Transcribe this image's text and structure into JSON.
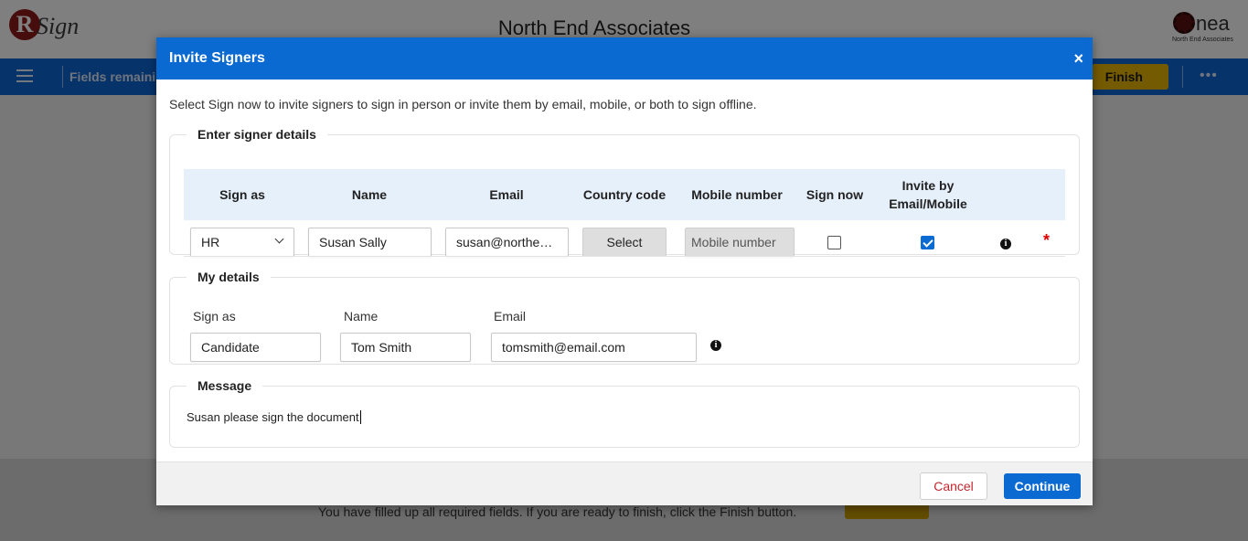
{
  "app": {
    "title": "North End Associates",
    "brand_logo": {
      "letter": "R",
      "text": "Sign"
    },
    "company_logo": {
      "text": "nea",
      "subtitle": "North End Associates"
    },
    "toolbar": {
      "fields_remaining_label": "Fields remainin",
      "finish_label": "Finish",
      "more_label": "•••"
    },
    "footer": {
      "message": "You have filled up all required fields. If you are ready to finish, click the Finish button."
    }
  },
  "modal": {
    "title": "Invite Signers",
    "close_label": "×",
    "intro": "Select Sign now to invite signers to sign in person or invite them by email, mobile, or both to sign offline.",
    "signer_section": {
      "legend": "Enter signer details",
      "columns": {
        "sign_as": "Sign as",
        "name": "Name",
        "email": "Email",
        "country_code": "Country code",
        "mobile_number": "Mobile number",
        "sign_now": "Sign now",
        "invite_line1": "Invite by",
        "invite_line2": "Email/Mobile"
      },
      "row": {
        "sign_as": "HR",
        "name": "Susan Sally",
        "email": "susan@northend...",
        "country_code_button": "Select",
        "mobile_placeholder": "Mobile number",
        "sign_now_checked": false,
        "invite_checked": true,
        "info_icon": "i",
        "required_mark": "*"
      }
    },
    "my_details": {
      "legend": "My details",
      "labels": {
        "sign_as": "Sign as",
        "name": "Name",
        "email": "Email"
      },
      "values": {
        "sign_as": "Candidate",
        "name": "Tom Smith",
        "email": "tomsmith@email.com"
      },
      "info_icon": "i"
    },
    "message_section": {
      "legend": "Message",
      "text": "Susan please sign the document"
    },
    "buttons": {
      "cancel": "Cancel",
      "continue": "Continue"
    }
  },
  "colors": {
    "primary_blue": "#0a6ad2",
    "finish_yellow": "#e8b500",
    "cancel_red": "#c1272d",
    "required_red": "#e00000",
    "table_header_bg": "#e6f0fb"
  }
}
